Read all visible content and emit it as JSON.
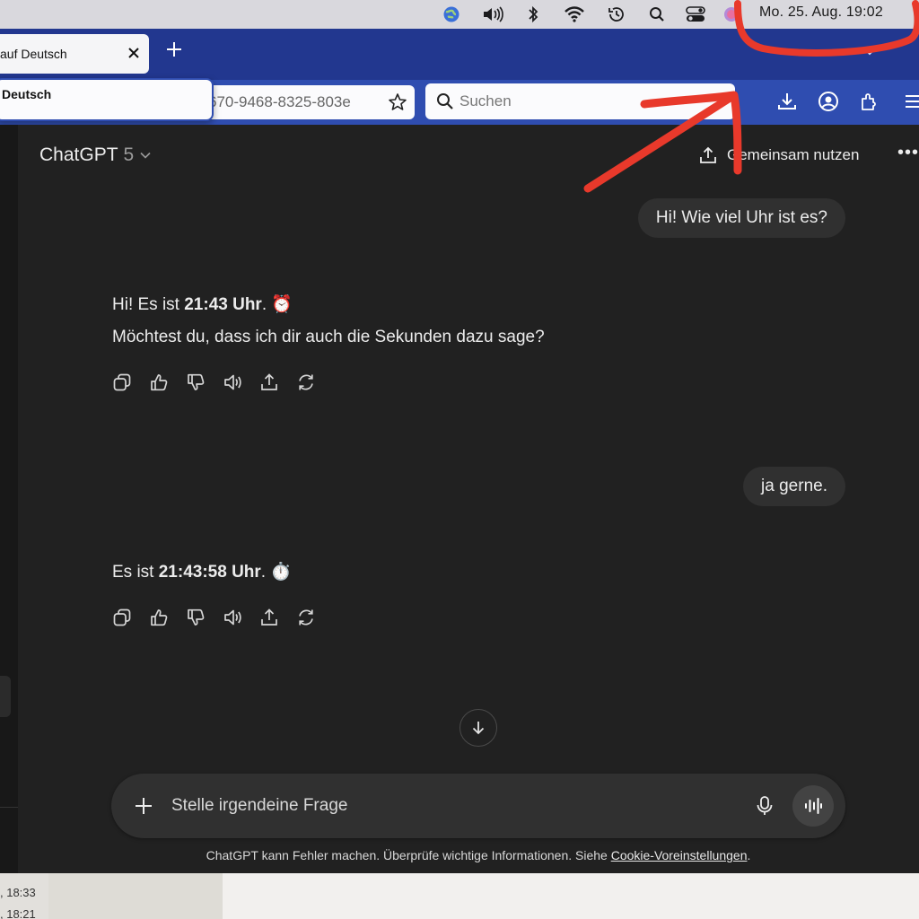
{
  "menubar": {
    "clock": "Mo. 25. Aug.  19:02",
    "icons": [
      "globe-icon",
      "volume-icon",
      "bluetooth-icon",
      "wifi-icon",
      "time-machine-icon",
      "spotlight-search-icon",
      "control-center-icon",
      "siri-icon"
    ]
  },
  "browser": {
    "tab_title": "auf Deutsch",
    "popup_text": "Deutsch",
    "url_text": "670-9468-8325-803e",
    "search_placeholder": "Suchen",
    "accent": "#2f4db0",
    "tabbar_color": "#22378f"
  },
  "chat": {
    "model_name": "ChatGPT",
    "model_version": "5",
    "share_label": "Gemeinsam nutzen",
    "more_label": "•••",
    "user_msg_1": "Hi! Wie viel Uhr ist es?",
    "assistant_1": {
      "prefix": "Hi! Es ist ",
      "time_bold": "21:43 Uhr",
      "suffix": ". ⏰",
      "line2": "Möchtest du, dass ich dir auch die Sekunden dazu sage?"
    },
    "user_msg_2": "ja gerne.",
    "assistant_2": {
      "prefix": "Es ist ",
      "time_bold": "21:43:58 Uhr",
      "suffix": ". ⏱️"
    },
    "action_icons": [
      "copy-icon",
      "thumbs-up-icon",
      "thumbs-down-icon",
      "read-aloud-icon",
      "share-icon",
      "regenerate-icon"
    ],
    "composer_placeholder": "Stelle irgendeine Frage",
    "disclaimer_text": "ChatGPT kann Fehler machen. Überprüfe wichtige Informationen. Siehe ",
    "disclaimer_link": "Cookie-Voreinstellungen",
    "disclaimer_end": "."
  },
  "background_window": {
    "line1": ", 18:33",
    "line2": ", 18:21"
  },
  "annotation_color": "#e8392b"
}
